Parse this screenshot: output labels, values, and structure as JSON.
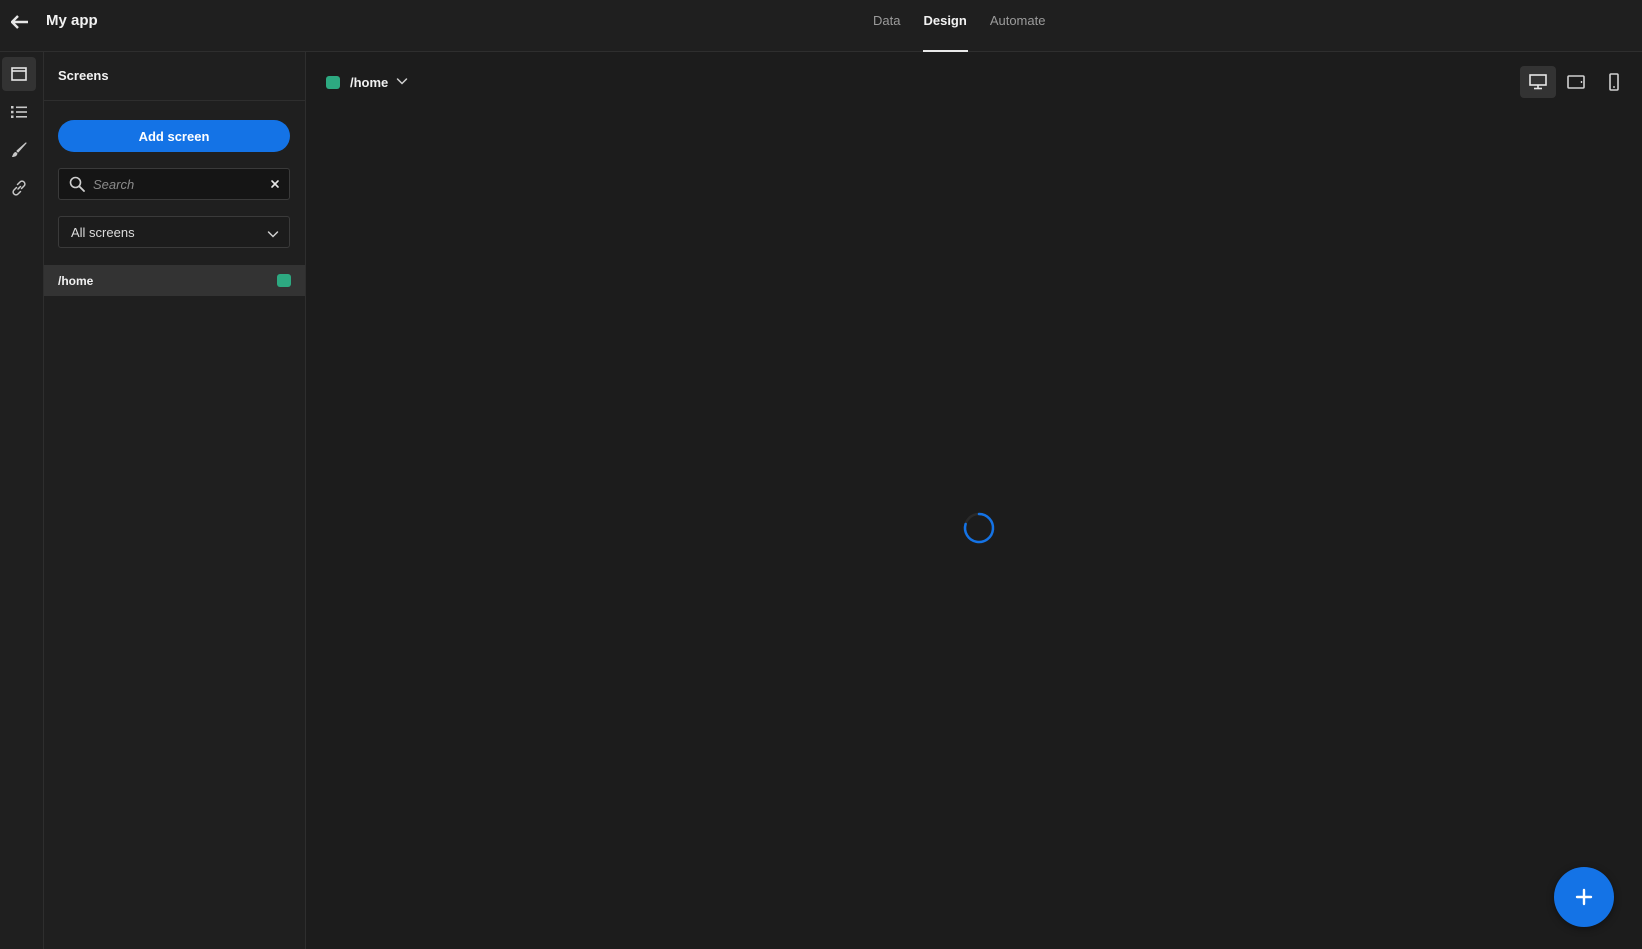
{
  "app": {
    "title": "My app",
    "back_icon": "back-arrow-icon"
  },
  "nav": {
    "tabs": [
      {
        "label": "Data",
        "active": false
      },
      {
        "label": "Design",
        "active": true
      },
      {
        "label": "Automate",
        "active": false
      }
    ]
  },
  "rail": {
    "items": [
      {
        "icon": "screens-icon",
        "active": true
      },
      {
        "icon": "list-icon",
        "active": false
      },
      {
        "icon": "brush-icon",
        "active": false
      },
      {
        "icon": "link-icon",
        "active": false
      }
    ]
  },
  "panel": {
    "title": "Screens",
    "add_button": "Add screen",
    "search": {
      "placeholder": "Search",
      "value": ""
    },
    "filter": {
      "selected": "All screens"
    },
    "screens": [
      {
        "route": "/home",
        "status_color": "#2da981"
      }
    ]
  },
  "canvas": {
    "route": "/home",
    "route_color": "#2da981",
    "devices": [
      {
        "icon": "desktop-icon",
        "active": true
      },
      {
        "icon": "tablet-icon",
        "active": false
      },
      {
        "icon": "mobile-icon",
        "active": false
      }
    ],
    "loading": true
  },
  "fab": {
    "icon": "plus-icon"
  },
  "colors": {
    "accent": "#1473e6",
    "background": "#1c1c1c",
    "status_green": "#2da981"
  }
}
